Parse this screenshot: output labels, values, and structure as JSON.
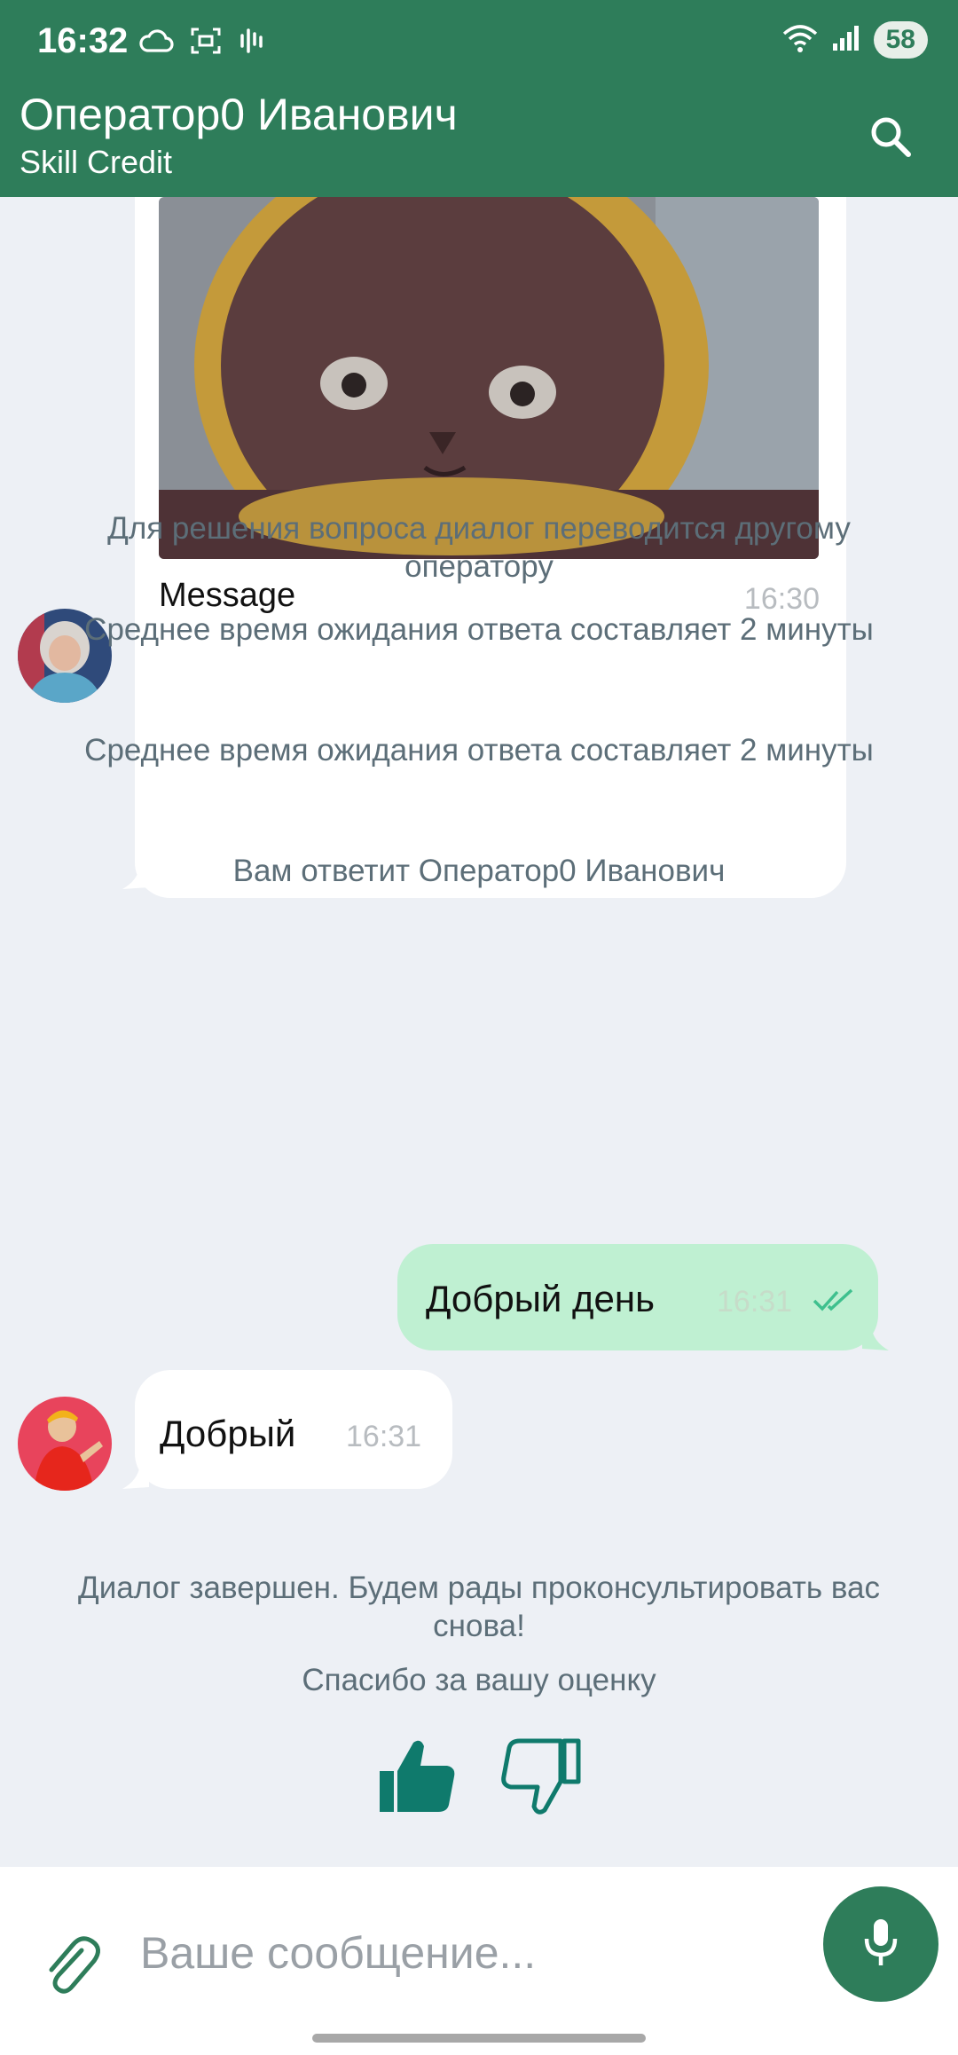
{
  "status_bar": {
    "time": "16:32",
    "battery": "58",
    "left_icons": [
      "cloud-icon",
      "screenshot-icon",
      "soundwave-icon"
    ],
    "right_icons": [
      "wifi-icon",
      "signal-icon"
    ]
  },
  "header": {
    "title": "Оператор0 Иванович",
    "subtitle": "Skill Credit"
  },
  "messages": {
    "image_message": {
      "caption": "Message",
      "time": "16:30"
    },
    "system_1": "Для решения вопроса диалог переводится другому оператору",
    "system_2": "Среднее время ожидания ответа составляет 2 минуты",
    "system_3": "Среднее время ожидания ответа составляет 2 минуты",
    "system_4": "Вам ответит Оператор0 Иванович",
    "outgoing": {
      "text": "Добрый день",
      "time": "16:31"
    },
    "incoming": {
      "text": "Добрый",
      "time": "16:31"
    },
    "system_5": "Диалог завершен. Будем рады проконсультировать вас снова!",
    "system_6": "Спасибо за вашу оценку"
  },
  "composer": {
    "placeholder": "Ваше сообщение..."
  },
  "colors": {
    "primary": "#2e7d5a",
    "outgoing_bubble": "#bff0d2",
    "background": "#edf0f5",
    "accent": "#0f7a6c"
  }
}
